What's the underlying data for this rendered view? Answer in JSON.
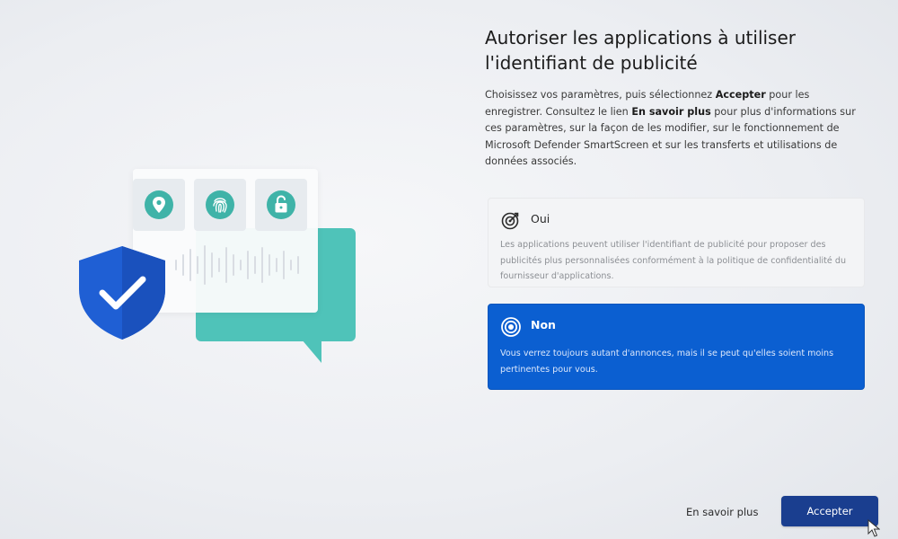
{
  "page": {
    "title_line1": "Autoriser les applications à utiliser",
    "title_line2": "l'identifiant de publicité",
    "description": {
      "part1": "Choisissez vos paramètres, puis sélectionnez ",
      "accept_bold": "Accepter",
      "part2": " pour les enregistrer. Consultez le lien ",
      "learn_more_bold": "En savoir plus",
      "part3": " pour plus d'informations sur ces paramètres, sur la façon de les modifier, sur le fonctionnement de Microsoft Defender SmartScreen et sur les transferts et utilisations de données associés."
    }
  },
  "options": [
    {
      "label": "Oui",
      "description": "Les applications peuvent utiliser l'identifiant de publicité pour proposer des publicités plus personnalisées conformément à la politique de confidentialité du fournisseur d'applications.",
      "selected": false
    },
    {
      "label": "Non",
      "description": "Vous verrez toujours autant d'annonces, mais il se peut qu'elles soient moins pertinentes pour vous.",
      "selected": true
    }
  ],
  "footer": {
    "learn_more_label": "En savoir plus",
    "accept_label": "Accepter"
  },
  "illustration": {
    "icons": [
      "location-pin-icon",
      "fingerprint-icon",
      "unlocked-padlock-icon",
      "shield-check-icon"
    ]
  },
  "colors": {
    "accent": "#0b5fd1",
    "accept_button": "#1a3e8f",
    "teal": "#4fc3b9",
    "shield": "#1f5fd4"
  }
}
